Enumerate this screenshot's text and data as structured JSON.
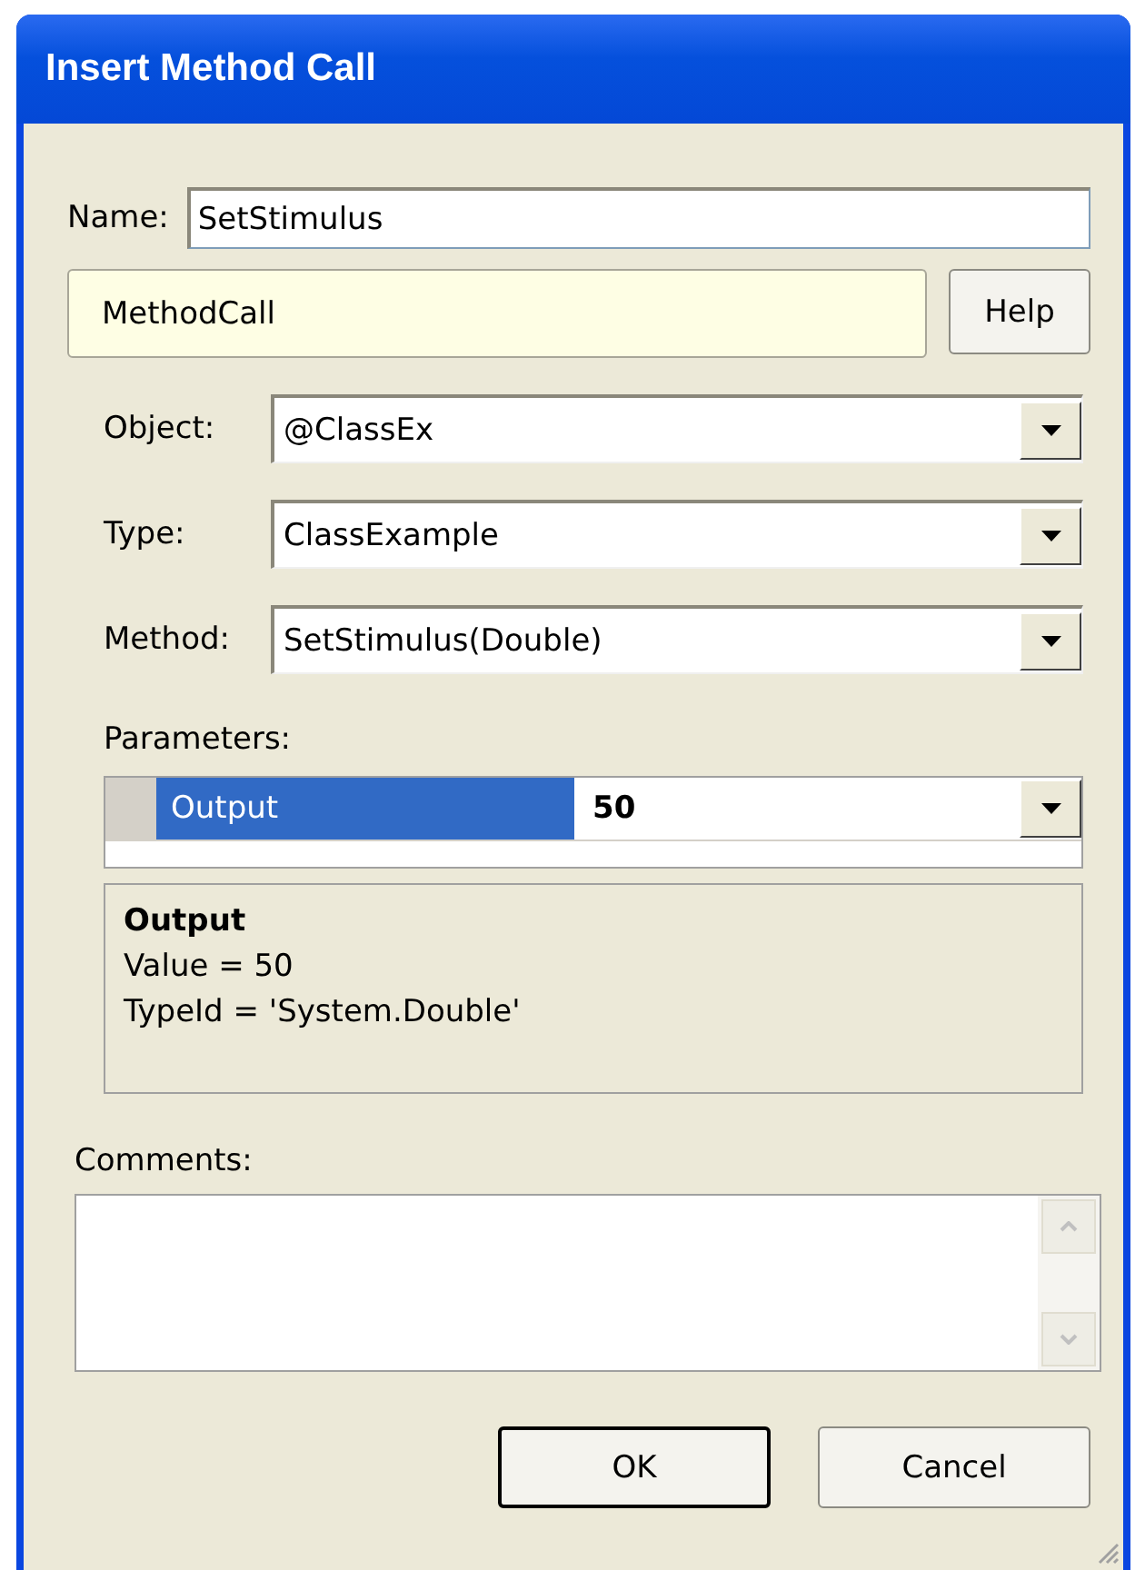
{
  "window": {
    "title": "Insert Method Call"
  },
  "name_field": {
    "label": "Name:",
    "value": "SetStimulus"
  },
  "header": {
    "text": "MethodCall",
    "help_button": "Help"
  },
  "combos": [
    {
      "label": "Object:",
      "value": "@ClassEx"
    },
    {
      "label": "Type:",
      "value": "ClassExample"
    },
    {
      "label": "Method:",
      "value": "SetStimulus(Double)"
    }
  ],
  "parameters": {
    "label": "Parameters:",
    "rows": [
      {
        "name": "Output",
        "value": "50",
        "selected": true
      }
    ]
  },
  "description": {
    "title": "Output",
    "lines": [
      "Value = 50",
      "TypeId = 'System.Double'"
    ]
  },
  "comments": {
    "label": "Comments:"
  },
  "buttons": [
    {
      "label": "OK",
      "default": true
    },
    {
      "label": "Cancel",
      "default": false
    }
  ]
}
